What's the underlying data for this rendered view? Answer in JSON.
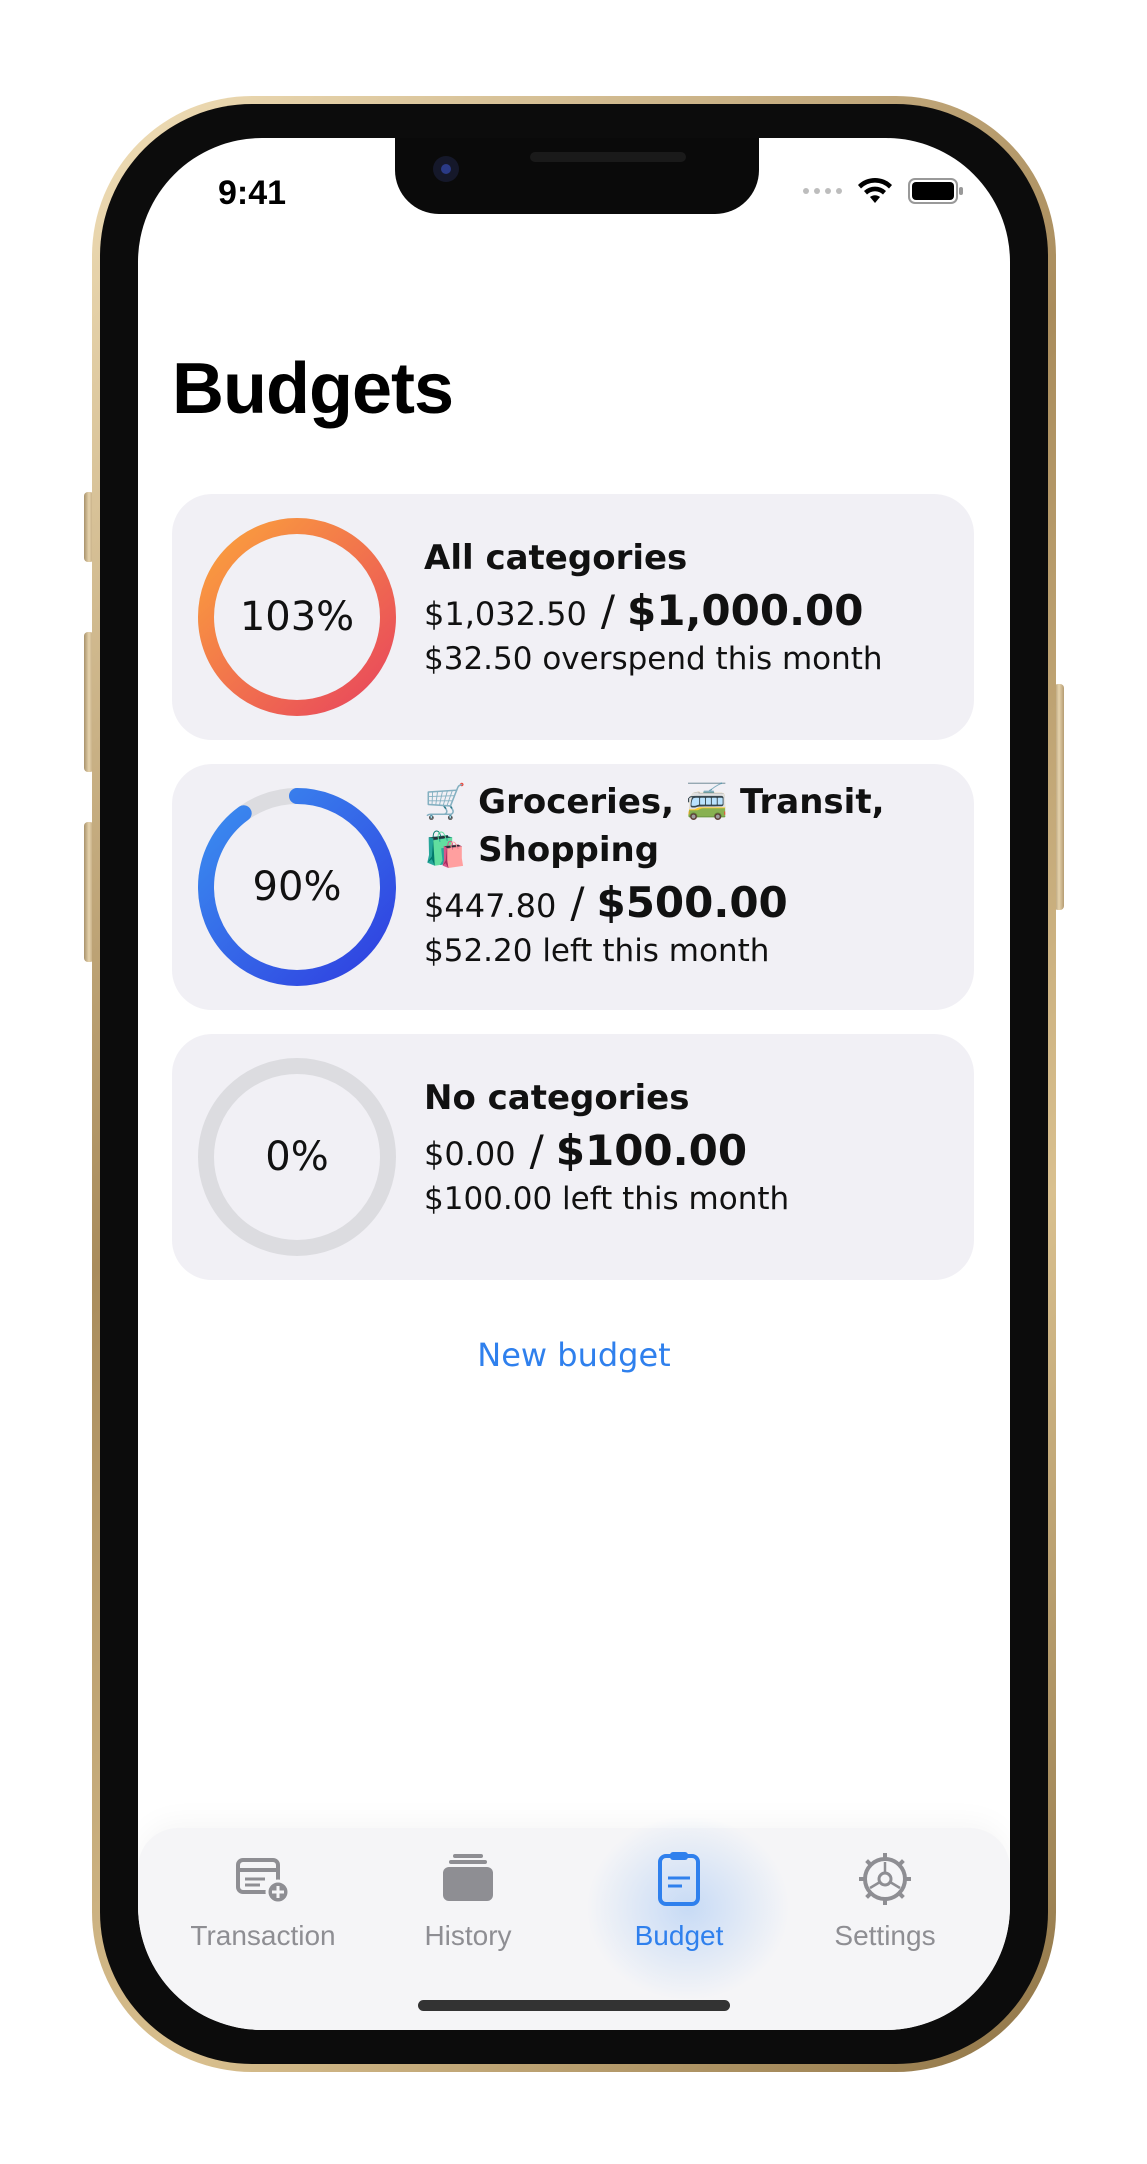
{
  "status_bar": {
    "time": "9:41"
  },
  "page": {
    "title": "Budgets"
  },
  "budgets": [
    {
      "percent_label": "103%",
      "progress": 1.03,
      "name": "All categories",
      "spent": "$1,032.50",
      "slash": "/",
      "limit": "$1,000.00",
      "remaining": "$32.50 overspend this month",
      "colors": [
        "#e8455d",
        "#fba23c"
      ]
    },
    {
      "percent_label": "90%",
      "progress": 0.9,
      "name": "🛒 Groceries, 🚎 Transit, 🛍️ Shopping",
      "spent": "$447.80",
      "slash": "/",
      "limit": "$500.00",
      "remaining": "$52.20 left this month",
      "colors": [
        "#2f3ee0",
        "#3b8ff0"
      ]
    },
    {
      "percent_label": "0%",
      "progress": 0,
      "name": "No categories",
      "spent": "$0.00",
      "slash": "/",
      "limit": "$100.00",
      "remaining": "$100.00 left this month",
      "colors": [
        "#d8d8dc",
        "#d8d8dc"
      ]
    }
  ],
  "actions": {
    "new_budget": "New budget"
  },
  "tabbar": {
    "tabs": [
      {
        "label": "Transaction",
        "icon": "transaction-add-icon",
        "active": false
      },
      {
        "label": "History",
        "icon": "history-stack-icon",
        "active": false
      },
      {
        "label": "Budget",
        "icon": "budget-clipboard-icon",
        "active": true
      },
      {
        "label": "Settings",
        "icon": "gear-icon",
        "active": false
      }
    ]
  },
  "colors": {
    "accent": "#2f80ed",
    "inactive": "#8e8e93",
    "card": "#f1f0f5"
  }
}
